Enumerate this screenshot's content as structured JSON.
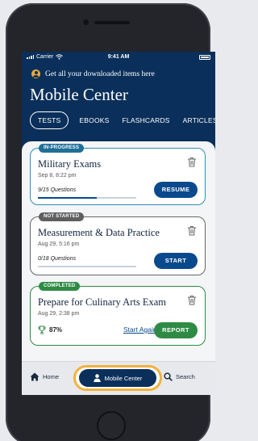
{
  "status_bar": {
    "carrier": "Carrier",
    "time": "9:41 AM"
  },
  "header": {
    "notice": "Get all your downloaded items here",
    "title": "Mobile Center",
    "tabs": [
      "TESTS",
      "EBOOKS",
      "FLASHCARDS",
      "ARTICLES"
    ]
  },
  "cards": [
    {
      "status": "IN-PROGRESS",
      "title": "Military Exams",
      "date": "Sep 8, 8:22 pm",
      "progress_text": "9/15 Questions",
      "progress": 0.6,
      "action": "RESUME"
    },
    {
      "status": "NOT STARTED",
      "title": "Measurement & Data Practice",
      "date": "Aug 29, 5:16 pm",
      "progress_text": "0/18 Questions",
      "progress": 0,
      "action": "START"
    },
    {
      "status": "COMPLETED",
      "title": "Prepare for Culinary Arts Exam",
      "date": "Aug 29, 2:38 pm",
      "score": "87%",
      "secondary_action": "Start Again",
      "action": "REPORT"
    }
  ],
  "nav": {
    "home": "Home",
    "mobile_center": "Mobile Center",
    "search": "Search"
  },
  "colors": {
    "navy": "#0a2f5a",
    "blue": "#0a4a8c",
    "green": "#2f8a45",
    "highlight": "#f2b23c"
  }
}
